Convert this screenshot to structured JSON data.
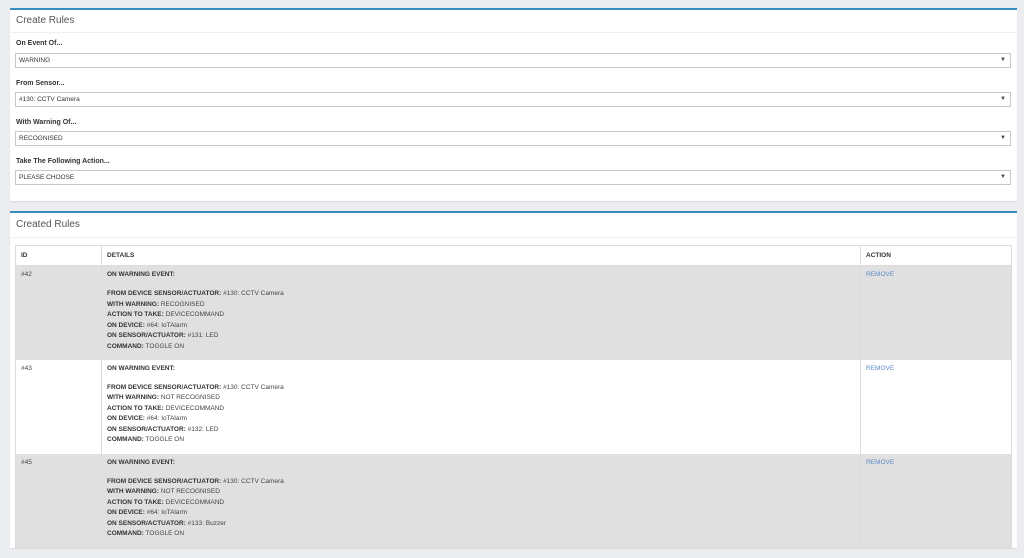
{
  "create_rules": {
    "title": "Create Rules",
    "fields": [
      {
        "label": "On Event Of...",
        "value": "WARNING"
      },
      {
        "label": "From Sensor...",
        "value": "#130: CCTV Camera"
      },
      {
        "label": "With Warning Of...",
        "value": "RECOGNISED"
      },
      {
        "label": "Take The Following Action...",
        "value": "PLEASE CHOOSE"
      }
    ]
  },
  "created_rules": {
    "title": "Created Rules",
    "columns": {
      "id": "ID",
      "details": "DETAILS",
      "action": "ACTION"
    },
    "rows": [
      {
        "id": "#42",
        "heading": "ON WARNING EVENT:",
        "lines": [
          {
            "k": "FROM DEVICE SENSOR/ACTUATOR:",
            "v": "#130: CCTV Camera"
          },
          {
            "k": "WITH WARNING:",
            "v": "RECOGNISED"
          },
          {
            "k": "ACTION TO TAKE:",
            "v": "DEVICECOMMAND"
          },
          {
            "k": "ON DEVICE:",
            "v": "#64: IoTAlarm"
          },
          {
            "k": "ON SENSOR/ACTUATOR:",
            "v": "#131: LED"
          },
          {
            "k": "COMMAND:",
            "v": "TOGGLE ON"
          }
        ],
        "action": "REMOVE"
      },
      {
        "id": "#43",
        "heading": "ON WARNING EVENT:",
        "lines": [
          {
            "k": "FROM DEVICE SENSOR/ACTUATOR:",
            "v": "#130: CCTV Camera"
          },
          {
            "k": "WITH WARNING:",
            "v": "NOT RECOGNISED"
          },
          {
            "k": "ACTION TO TAKE:",
            "v": "DEVICECOMMAND"
          },
          {
            "k": "ON DEVICE:",
            "v": "#64: IoTAlarm"
          },
          {
            "k": "ON SENSOR/ACTUATOR:",
            "v": "#132: LED"
          },
          {
            "k": "COMMAND:",
            "v": "TOGGLE ON"
          }
        ],
        "action": "REMOVE"
      },
      {
        "id": "#45",
        "heading": "ON WARNING EVENT:",
        "lines": [
          {
            "k": "FROM DEVICE SENSOR/ACTUATOR:",
            "v": "#130: CCTV Camera"
          },
          {
            "k": "WITH WARNING:",
            "v": "NOT RECOGNISED"
          },
          {
            "k": "ACTION TO TAKE:",
            "v": "DEVICECOMMAND"
          },
          {
            "k": "ON DEVICE:",
            "v": "#64: IoTAlarm"
          },
          {
            "k": "ON SENSOR/ACTUATOR:",
            "v": "#133: Buzzer"
          },
          {
            "k": "COMMAND:",
            "v": "TOGGLE ON"
          }
        ],
        "action": "REMOVE"
      }
    ]
  }
}
